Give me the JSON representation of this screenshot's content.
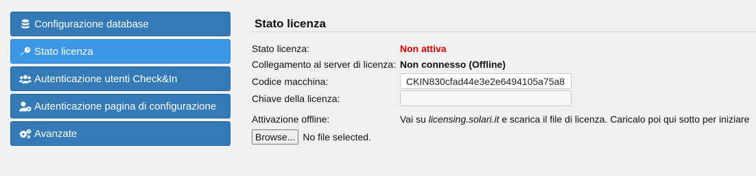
{
  "sidebar": {
    "items": [
      {
        "label": "Configurazione database",
        "icon": "database-icon",
        "active": false
      },
      {
        "label": "Stato licenza",
        "icon": "key-icon",
        "active": true
      },
      {
        "label": "Autenticazione utenti Check&In",
        "icon": "users-icon",
        "active": false
      },
      {
        "label": "Autenticazione pagina di configurazione",
        "icon": "user-gear-icon",
        "active": false
      },
      {
        "label": "Avanzate",
        "icon": "gears-icon",
        "active": false
      }
    ]
  },
  "license": {
    "title": "Stato licenza",
    "status_label": "Stato licenza:",
    "status_value": "Non attiva",
    "server_label": "Collegamento al server di licenza:",
    "server_value": "Non connesso (Offline)",
    "machine_code_label": "Codice macchina:",
    "machine_code_value": "CKIN830cfad44e3e2e6494105a75a8",
    "license_key_label": "Chiave della licenza:",
    "license_key_value": "",
    "offline_label": "Attivazione offline:",
    "offline_text_before": "Vai su ",
    "offline_link": "licensing.solari.it",
    "offline_text_after": " e scarica il file di licenza. Caricalo poi qui sotto per iniziare",
    "browse_label": "Browse...",
    "no_file_text": "No file selected."
  },
  "colors": {
    "nav_bg": "#337ab7",
    "nav_active_bg": "#3c98e6",
    "status_red": "#e00000",
    "page_bg": "#f0f0f0"
  }
}
